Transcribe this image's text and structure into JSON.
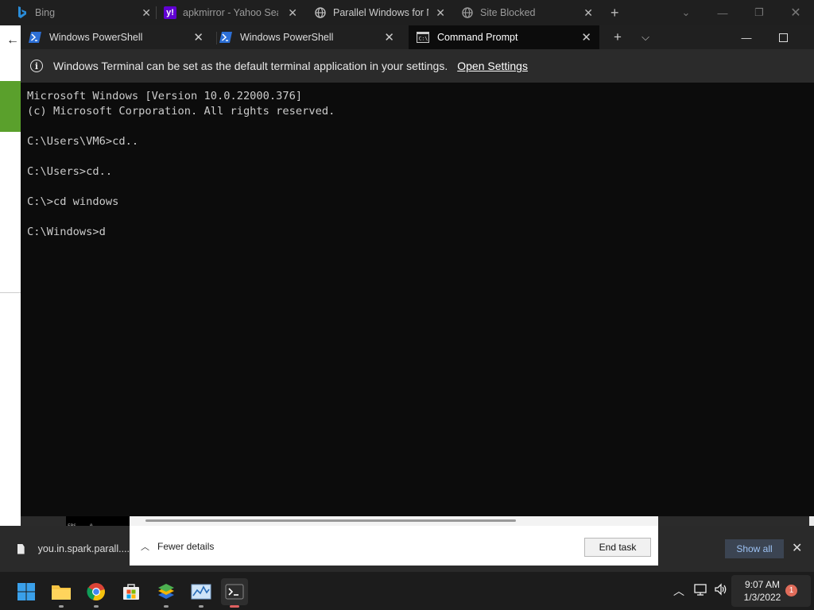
{
  "browser": {
    "tabs": [
      {
        "title": "Bing",
        "icon": "bing-icon"
      },
      {
        "title": "apkmirror - Yahoo Sear",
        "icon": "yahoo-icon"
      },
      {
        "title": "Parallel Windows for N",
        "icon": "globe-icon"
      },
      {
        "title": "Site Blocked",
        "icon": "globe-icon"
      }
    ]
  },
  "terminal": {
    "tabs": [
      {
        "title": "Windows PowerShell",
        "icon": "powershell-icon"
      },
      {
        "title": "Windows PowerShell",
        "icon": "powershell-icon"
      },
      {
        "title": "Command Prompt",
        "icon": "cmd-icon",
        "active": true
      }
    ],
    "infobar": {
      "message": "Windows Terminal can be set as the default terminal application in your settings.",
      "link": "Open Settings"
    },
    "lines": [
      "Microsoft Windows [Version 10.0.22000.376]",
      "(c) Microsoft Corporation. All rights reserved.",
      "",
      "C:\\Users\\VM6>cd..",
      "",
      "C:\\Users>cd..",
      "",
      "C:\\>cd windows",
      "",
      "C:\\Windows>d"
    ]
  },
  "task_manager": {
    "fewer_details": "Fewer details",
    "end_task": "End task"
  },
  "fps_overlay": {
    "label": "FPS",
    "value": "0"
  },
  "downloads": {
    "file_name": "you.in.spark.parall....",
    "show_all": "Show all"
  },
  "taskbar": {
    "apps": [
      "start-icon",
      "file-explorer-icon",
      "chrome-icon",
      "store-icon",
      "bluestacks-icon",
      "performance-monitor-icon",
      "terminal-icon"
    ],
    "time": "9:07 AM",
    "date": "1/3/2022",
    "notification_count": "1"
  },
  "colors": {
    "terminal_bg": "#0c0c0c",
    "console_text": "#cccccc",
    "accent_green": "#5aa02c",
    "notification": "#e06c5a"
  }
}
